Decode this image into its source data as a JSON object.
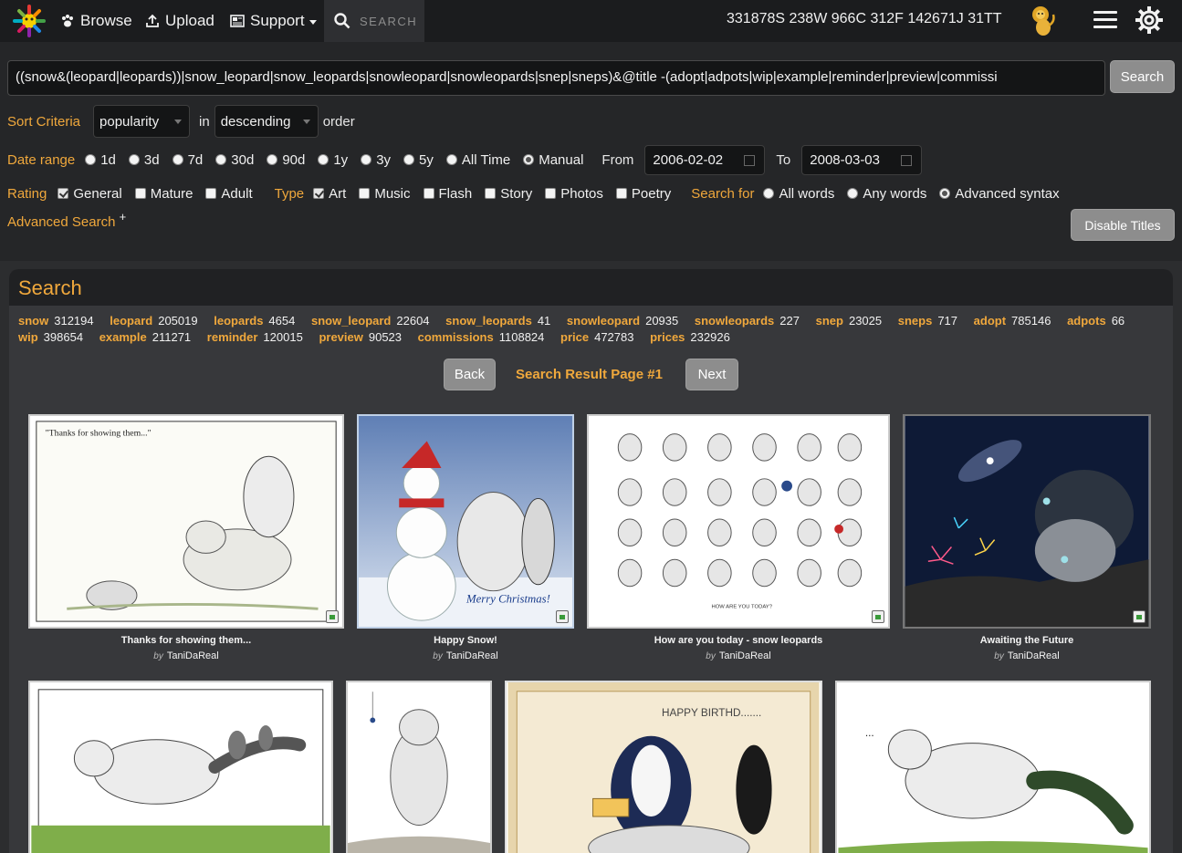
{
  "nav": {
    "browse": "Browse",
    "upload": "Upload",
    "support": "Support",
    "search_placeholder": "SEARCH",
    "stats": "331878S 238W 966C 312F 142671J 31TT"
  },
  "form": {
    "query": "((snow&(leopard|leopards))|snow_leopard|snow_leopards|snowleopard|snowleopards|snep|sneps)&@title -(adopt|adpots|wip|example|reminder|preview|commissi",
    "search_button": "Search",
    "sort_label": "Sort Criteria",
    "sort_value": "popularity",
    "in_text": "in",
    "order_value": "descending",
    "order_text": "order",
    "date_label": "Date range",
    "date_options": [
      "1d",
      "3d",
      "7d",
      "30d",
      "90d",
      "1y",
      "3y",
      "5y",
      "All Time",
      "Manual"
    ],
    "date_selected": "Manual",
    "from_label": "From",
    "from_value": "2006-02-02",
    "to_label": "To",
    "to_value": "2008-03-03",
    "rating_label": "Rating",
    "ratings": [
      {
        "label": "General",
        "checked": true
      },
      {
        "label": "Mature",
        "checked": false
      },
      {
        "label": "Adult",
        "checked": false
      }
    ],
    "type_label": "Type",
    "types": [
      {
        "label": "Art",
        "checked": true
      },
      {
        "label": "Music",
        "checked": false
      },
      {
        "label": "Flash",
        "checked": false
      },
      {
        "label": "Story",
        "checked": false
      },
      {
        "label": "Photos",
        "checked": false
      },
      {
        "label": "Poetry",
        "checked": false
      }
    ],
    "searchfor_label": "Search for",
    "searchfor_options": [
      "All words",
      "Any words",
      "Advanced syntax"
    ],
    "searchfor_selected": "Advanced syntax",
    "advanced_link": "Advanced Search",
    "advanced_plus": "+",
    "disable_titles": "Disable Titles"
  },
  "results": {
    "heading": "Search",
    "terms": [
      {
        "term": "snow",
        "count": "312194"
      },
      {
        "term": "leopard",
        "count": "205019"
      },
      {
        "term": "leopards",
        "count": "4654"
      },
      {
        "term": "snow_leopard",
        "count": "22604"
      },
      {
        "term": "snow_leopards",
        "count": "41"
      },
      {
        "term": "snowleopard",
        "count": "20935"
      },
      {
        "term": "snowleopards",
        "count": "227"
      },
      {
        "term": "snep",
        "count": "23025"
      },
      {
        "term": "sneps",
        "count": "717"
      },
      {
        "term": "adopt",
        "count": "785146"
      },
      {
        "term": "adpots",
        "count": "66"
      },
      {
        "term": "wip",
        "count": "398654"
      },
      {
        "term": "example",
        "count": "211271"
      },
      {
        "term": "reminder",
        "count": "120015"
      },
      {
        "term": "preview",
        "count": "90523"
      },
      {
        "term": "commissions",
        "count": "1108824"
      },
      {
        "term": "price",
        "count": "472783"
      },
      {
        "term": "prices",
        "count": "232926"
      }
    ],
    "back": "Back",
    "page_label": "Search Result Page #1",
    "next": "Next",
    "by": "by",
    "items": [
      {
        "title": "Thanks for showing them...",
        "author": "TaniDaReal",
        "art_text": "\"Thanks for showing them...\""
      },
      {
        "title": "Happy Snow!",
        "author": "TaniDaReal",
        "art_text": "Merry Christmas!"
      },
      {
        "title": "How are you today - snow leopards",
        "author": "TaniDaReal",
        "art_text": "HOW ARE YOU TODAY?"
      },
      {
        "title": "Awaiting the Future",
        "author": "TaniDaReal",
        "art_text": ""
      },
      {
        "title": "",
        "author": "",
        "art_text": ""
      },
      {
        "title": "",
        "author": "",
        "art_text": ""
      },
      {
        "title": "",
        "author": "",
        "art_text": "HAPPY BIRTHD......."
      },
      {
        "title": "",
        "author": "",
        "art_text": "..."
      }
    ]
  },
  "colors": {
    "accent": "#f0a83c",
    "navbar": "#1b1c1e",
    "panel": "#37383b",
    "button": "#8d8d8d"
  }
}
